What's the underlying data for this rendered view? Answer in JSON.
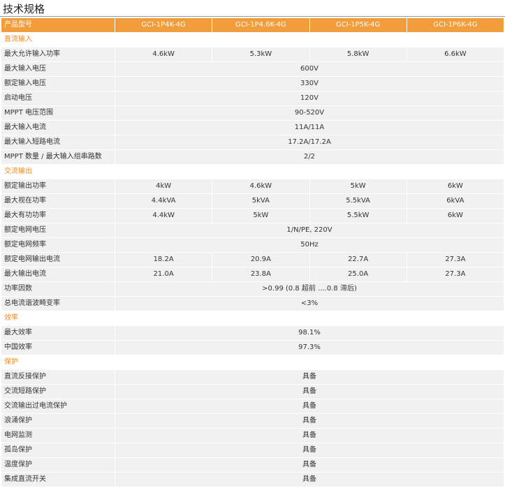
{
  "title": "技术规格",
  "header": {
    "label": "产品型号",
    "models": [
      "GCI-1P4K-4G",
      "GCI-1P4.6K-4G",
      "GCI-1P5K-4G",
      "GCI-1P6K-4G"
    ]
  },
  "sections": [
    {
      "name": "直流输入",
      "rows": [
        {
          "label": "最大允许输入功率",
          "values": [
            "4.6kW",
            "5.3kW",
            "5.8kW",
            "6.6kW"
          ]
        },
        {
          "label": "最大输入电压",
          "values": [
            "600V"
          ]
        },
        {
          "label": "额定输入电压",
          "values": [
            "330V"
          ]
        },
        {
          "label": "启动电压",
          "values": [
            "120V"
          ]
        },
        {
          "label": "MPPT 电压范围",
          "values": [
            "90-520V"
          ]
        },
        {
          "label": "最大输入电流",
          "values": [
            "11A/11A"
          ]
        },
        {
          "label": "最大输入短路电流",
          "values": [
            "17.2A/17.2A"
          ]
        },
        {
          "label": "MPPT 数量 / 最大输入组串路数",
          "values": [
            "2/2"
          ]
        }
      ]
    },
    {
      "name": "交流输出",
      "rows": [
        {
          "label": "额定输出功率",
          "values": [
            "4kW",
            "4.6kW",
            "5kW",
            "6kW"
          ]
        },
        {
          "label": "最大视在功率",
          "values": [
            "4.4kVA",
            "5kVA",
            "5.5kVA",
            "6kVA"
          ]
        },
        {
          "label": "最大有功功率",
          "values": [
            "4.4kW",
            "5kW",
            "5.5kW",
            "6kW"
          ]
        },
        {
          "label": "额定电网电压",
          "values": [
            "1/N/PE, 220V"
          ]
        },
        {
          "label": "额定电网频率",
          "values": [
            "50Hz"
          ]
        },
        {
          "label": "额定电网输出电流",
          "values": [
            "18.2A",
            "20.9A",
            "22.7A",
            "27.3A"
          ]
        },
        {
          "label": "最大输出电流",
          "values": [
            "21.0A",
            "23.8A",
            "25.0A",
            "27.3A"
          ]
        },
        {
          "label": "功率因数",
          "values": [
            ">0.99 (0.8 超前 ....0.8 滞后)"
          ]
        },
        {
          "label": "总电流谐波畸变率",
          "values": [
            "<3%"
          ]
        }
      ]
    },
    {
      "name": "效率",
      "rows": [
        {
          "label": "最大效率",
          "values": [
            "98.1%"
          ]
        },
        {
          "label": "中国效率",
          "values": [
            "97.3%"
          ]
        }
      ]
    },
    {
      "name": "保护",
      "rows": [
        {
          "label": "直流反接保护",
          "values": [
            "具备"
          ]
        },
        {
          "label": "交流短路保护",
          "values": [
            "具备"
          ]
        },
        {
          "label": "交流输出过电流保护",
          "values": [
            "具备"
          ]
        },
        {
          "label": "浪涌保护",
          "values": [
            "具备"
          ]
        },
        {
          "label": "电网监测",
          "values": [
            "具备"
          ]
        },
        {
          "label": "孤岛保护",
          "values": [
            "具备"
          ]
        },
        {
          "label": "温度保护",
          "values": [
            "具备"
          ]
        },
        {
          "label": "集成直流开关",
          "values": [
            "具备"
          ]
        }
      ]
    }
  ]
}
